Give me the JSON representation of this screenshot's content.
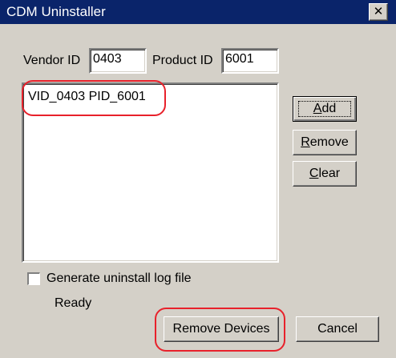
{
  "window": {
    "title": "CDM Uninstaller",
    "close_glyph": "✕"
  },
  "colors": {
    "titlebar": "#0a246a",
    "dialog_face": "#d4d0c8",
    "highlight_annotation": "#e8212b"
  },
  "form": {
    "vendor_label": "Vendor ID",
    "vendor_value": "0403",
    "product_label": "Product ID",
    "product_value": "6001"
  },
  "device_list": {
    "items": [
      "VID_0403 PID_6001"
    ]
  },
  "buttons": {
    "add": {
      "label": "Add"
    },
    "remove": {
      "label": "Remove"
    },
    "clear": {
      "label": "Clear"
    },
    "remove_devices": {
      "label": "Remove Devices"
    },
    "cancel": {
      "label": "Cancel"
    }
  },
  "log_checkbox": {
    "label": "Generate uninstall log file",
    "checked": false
  },
  "status": {
    "text": "Ready"
  }
}
